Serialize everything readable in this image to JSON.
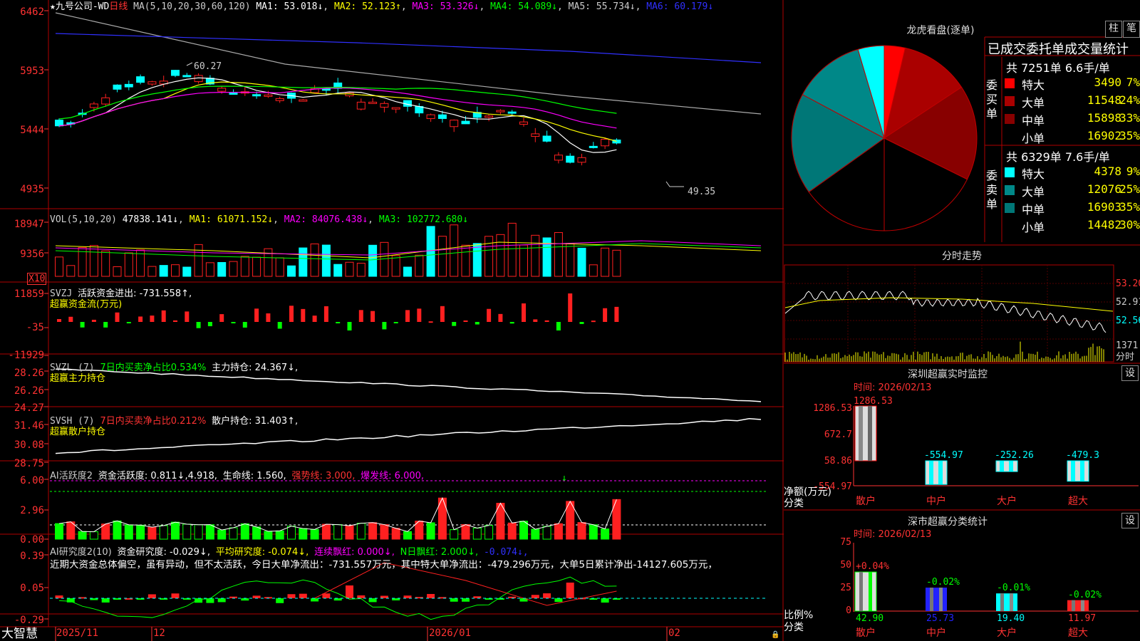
{
  "colors": {
    "up": "#ff2020",
    "down": "#00ffff",
    "ma1": "#ffffff",
    "ma2": "#ffff00",
    "ma3": "#ff00ff",
    "ma4": "#00ff00",
    "ma5": "#aaaaaa",
    "ma6": "#3030ff",
    "axis": "#ff3232"
  },
  "main": {
    "title": "★九号公司-WD",
    "period": "日线",
    "ma_params": "MA(5,10,20,30,60,120)",
    "ma1": "MA1: 53.018↓",
    "ma2": "MA2: 52.123↑",
    "ma3": "MA3: 53.326↓",
    "ma4": "MA4: 54.089↓",
    "ma5": "MA5: 55.734↓",
    "ma6": "MA6: 60.179↓",
    "y_labels": [
      "6462",
      "5953",
      "5444",
      "4935"
    ],
    "high_mark": "60.27",
    "low_mark": "49.35"
  },
  "vol": {
    "header_name": "VOL(5,10,20)",
    "value": "47838.141↓",
    "ma1": "MA1: 61071.152↓",
    "ma2": "MA2: 84076.438↓",
    "ma3": "MA3: 102772.680↓",
    "y_labels": [
      "18947",
      "9356"
    ],
    "unit": "X10"
  },
  "svzj": {
    "name": "SVZJ",
    "label": "活跃资金进出: -731.558↑,",
    "subtitle": "超赢资金流(万元)",
    "y_labels": [
      "11859",
      "-35",
      "-11929"
    ]
  },
  "svzl": {
    "name": "SVZL (7)",
    "ratio": "7日内买卖净占比0.534%",
    "hold": "主力持仓: 24.367↓,",
    "subtitle": "超赢主力持仓",
    "y_labels": [
      "28.26",
      "26.26",
      "24.27"
    ]
  },
  "svsh": {
    "name": "SVSH (7)",
    "ratio": "7日内买卖净占比0.212%",
    "hold": "散户持仓: 31.403↑,",
    "subtitle": "超赢散户持仓",
    "y_labels": [
      "31.46",
      "30.08",
      "28.75"
    ]
  },
  "ai_active": {
    "name": "AI活跃度2",
    "activity": "资金活跃度: 0.811↓,4.918,",
    "life": "生命线: 1.560,",
    "strong": "强势线: 3.000,",
    "burst": "爆发线: 6.000,",
    "y_labels": [
      "6.00",
      "2.96",
      "0.00"
    ]
  },
  "ai_research": {
    "name": "AI研究度2(10)",
    "research": "资金研究度: -0.029↓,",
    "avg": "平均研究度: -0.074↓,",
    "cont": "连续飘红: 0.000↓,",
    "nday": "N日飘红: 2.000↓,",
    "last": "-0.074↓,",
    "comment": "近期大资金总体偏空，虽有异动，但不太活跃，今日大单净流出：-731.557万元，其中特大单净流出：-479.296万元，大单5日累计净出-14127.605万元，",
    "y_labels": [
      "0.39",
      "0.05",
      "-0.29"
    ]
  },
  "bottom": {
    "brand": "大智慧",
    "dates": [
      "2025/11",
      "12",
      "2026/01",
      "02"
    ]
  },
  "dragon": {
    "title": "龙虎看盘(逐单)",
    "btn_col": "柱",
    "btn_pen": "笔",
    "stat_title": "已成交委托单成交量统计",
    "buy_side_label": "委买单",
    "sell_side_label": "委卖单",
    "buy_total": "共 7251单 6.6手/单",
    "sell_total": "共 6329单 7.6手/单",
    "buy_rows": [
      {
        "name": "特大",
        "vol": "3490",
        "pct": "7%",
        "color": "#ff0000"
      },
      {
        "name": "大单",
        "vol": "11548",
        "pct": "24%",
        "color": "#aa0000"
      },
      {
        "name": "中单",
        "vol": "15898",
        "pct": "33%",
        "color": "#880000"
      },
      {
        "name": "小单",
        "vol": "16902",
        "pct": "35%",
        "color": "#000000"
      }
    ],
    "sell_rows": [
      {
        "name": "特大",
        "vol": "4378",
        "pct": "9%",
        "color": "#00ffff"
      },
      {
        "name": "大单",
        "vol": "12076",
        "pct": "25%",
        "color": "#008888"
      },
      {
        "name": "中单",
        "vol": "16903",
        "pct": "35%",
        "color": "#007777"
      },
      {
        "name": "小单",
        "vol": "14482",
        "pct": "30%",
        "color": "#000000"
      }
    ]
  },
  "intraday": {
    "title": "分时走势",
    "price_labels": [
      "53.20",
      "52.91",
      "52.56"
    ],
    "vol_label": "1371",
    "unit_label": "分时"
  },
  "monitor": {
    "title": "深圳超赢实时监控",
    "btn": "设",
    "time": "时间: 2026/02/13",
    "y_labels": [
      "1286.53",
      "672.7",
      "58.86",
      "-554.97"
    ],
    "axis_title": "净额(万元)",
    "axis_sub": "分类",
    "bars": [
      {
        "cat": "散户",
        "value": 1286.53,
        "label": "1286.53"
      },
      {
        "cat": "中户",
        "value": -554.97,
        "label": "-554.97"
      },
      {
        "cat": "大户",
        "value": -252.26,
        "label": "-252.26"
      },
      {
        "cat": "超大",
        "value": -479.3,
        "label": "-479.3"
      }
    ]
  },
  "classify": {
    "title": "深市超赢分类统计",
    "btn": "设",
    "time": "时间: 2026/02/13",
    "y_labels": [
      "75",
      "50",
      "25",
      "0"
    ],
    "axis_title": "比例%",
    "axis_sub": "分类",
    "bars": [
      {
        "cat": "散户",
        "value": 42.9,
        "label": "42.90",
        "change": "+0.04%"
      },
      {
        "cat": "中户",
        "value": 25.73,
        "label": "25.73",
        "change": "-0.02%"
      },
      {
        "cat": "大户",
        "value": 19.4,
        "label": "19.40",
        "change": "-0.01%"
      },
      {
        "cat": "超大",
        "value": 11.97,
        "label": "11.97",
        "change": "-0.02%"
      }
    ]
  }
}
